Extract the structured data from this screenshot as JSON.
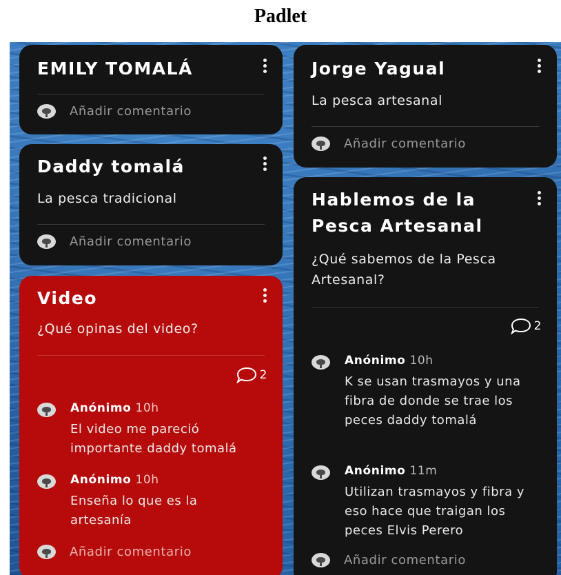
{
  "page_title": "Padlet",
  "add_comment_label": "Añadir comentario",
  "cards": {
    "emily": {
      "title": "EMILY TOMALÁ"
    },
    "daddy": {
      "title": "Daddy tomalá",
      "body": "La pesca tradicional"
    },
    "video": {
      "title": "Video",
      "body": "¿Qué opinas del video?",
      "comment_count": "2",
      "comments": [
        {
          "author": "Anónimo",
          "time": "10h",
          "text": "El video me pareció importante daddy tomalá"
        },
        {
          "author": "Anónimo",
          "time": "10h",
          "text": "Enseña lo que es la artesanía"
        }
      ]
    },
    "jorge": {
      "title": "Jorge Yagual",
      "body": "La pesca artesanal"
    },
    "hablemos": {
      "title": "Hablemos de la Pesca Artesanal",
      "body": "¿Qué sabemos de la Pesca Artesanal?",
      "comment_count": "2",
      "comments": [
        {
          "author": "Anónimo",
          "time": "10h",
          "text": "K se usan trasmayos y una fibra de donde se trae los peces daddy tomalá"
        },
        {
          "author": "Anónimo",
          "time": "11m",
          "text": "Utilizan trasmayos y fibra y eso hace que traigan los peces Elvis Perero"
        }
      ]
    }
  },
  "colors": {
    "card_dark": "#141414",
    "card_red": "#b70b0b",
    "board_blue": "#2a66a8"
  },
  "icons": [
    "more-vertical-icon",
    "speech-bubble-icon",
    "anonymous-avatar-icon"
  ]
}
